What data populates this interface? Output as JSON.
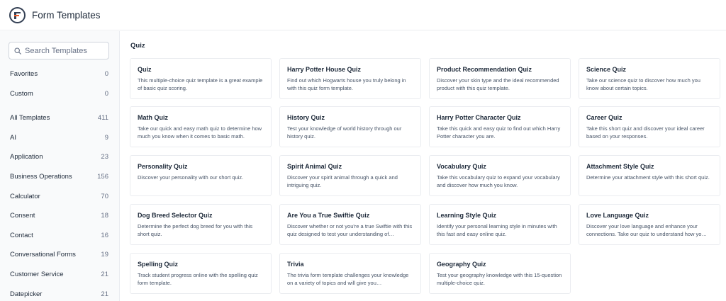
{
  "header": {
    "title": "Form Templates"
  },
  "sidebar": {
    "search_placeholder": "Search Templates",
    "categories": [
      {
        "label": "Favorites",
        "count": "0"
      },
      {
        "label": "Custom",
        "count": "0"
      },
      {
        "label": "All Templates",
        "count": "411"
      },
      {
        "label": "AI",
        "count": "9"
      },
      {
        "label": "Application",
        "count": "23"
      },
      {
        "label": "Business Operations",
        "count": "156"
      },
      {
        "label": "Calculator",
        "count": "70"
      },
      {
        "label": "Consent",
        "count": "18"
      },
      {
        "label": "Contact",
        "count": "16"
      },
      {
        "label": "Conversational Forms",
        "count": "19"
      },
      {
        "label": "Customer Service",
        "count": "21"
      },
      {
        "label": "Datepicker",
        "count": "21"
      }
    ]
  },
  "main": {
    "section_title": "Quiz",
    "cards": [
      {
        "title": "Quiz",
        "desc": "This multiple-choice quiz template is a great example of basic quiz scoring."
      },
      {
        "title": "Harry Potter House Quiz",
        "desc": "Find out which Hogwarts house you truly belong in with this quiz form template."
      },
      {
        "title": "Product Recommendation Quiz",
        "desc": "Discover your skin type and the ideal recommended product with this quiz template."
      },
      {
        "title": "Science Quiz",
        "desc": "Take our science quiz to discover how much you know about certain topics."
      },
      {
        "title": "Math Quiz",
        "desc": "Take our quick and easy math quiz to determine how much you know when it comes to basic math."
      },
      {
        "title": "History Quiz",
        "desc": "Test your knowledge of world history through our history quiz."
      },
      {
        "title": "Harry Potter Character Quiz",
        "desc": "Take this quick and easy quiz to find out which Harry Potter character you are."
      },
      {
        "title": "Career Quiz",
        "desc": "Take this short quiz and discover your ideal career based on your responses."
      },
      {
        "title": "Personality Quiz",
        "desc": "Discover your personality with our short quiz."
      },
      {
        "title": "Spirit Animal Quiz",
        "desc": "Discover your spirit animal through a quick and intriguing quiz."
      },
      {
        "title": "Vocabulary Quiz",
        "desc": "Take this vocabulary quiz to expand your vocabulary and discover how much you know."
      },
      {
        "title": "Attachment Style Quiz",
        "desc": "Determine your attachment style with this short quiz."
      },
      {
        "title": "Dog Breed Selector Quiz",
        "desc": "Determine the perfect dog breed for you with this short quiz."
      },
      {
        "title": "Are You a True Swiftie Quiz",
        "desc": "Discover whether or not you're a true Swiftie with this quiz designed to test your understanding of…"
      },
      {
        "title": "Learning Style Quiz",
        "desc": "Identify your personal learning style in minutes with this fast and easy online quiz."
      },
      {
        "title": "Love Language Quiz",
        "desc": "Discover your love language and enhance your connections. Take our quiz to understand how yo…"
      },
      {
        "title": "Spelling Quiz",
        "desc": "Track student progress online with the spelling quiz form template."
      },
      {
        "title": "Trivia",
        "desc": "The trivia form template challenges your knowledge on a variety of topics and will give you…"
      },
      {
        "title": "Geography Quiz",
        "desc": "Test your geography knowledge with this 15-question multiple-choice quiz."
      }
    ]
  },
  "colors": {
    "accent": "#f15a24",
    "text": "#1d2939",
    "muted": "#475467",
    "border": "#eaecf0",
    "sidebar_bg": "#f9fafb"
  },
  "icons": {
    "logo": "formidable-logo-icon",
    "search": "search-icon"
  }
}
